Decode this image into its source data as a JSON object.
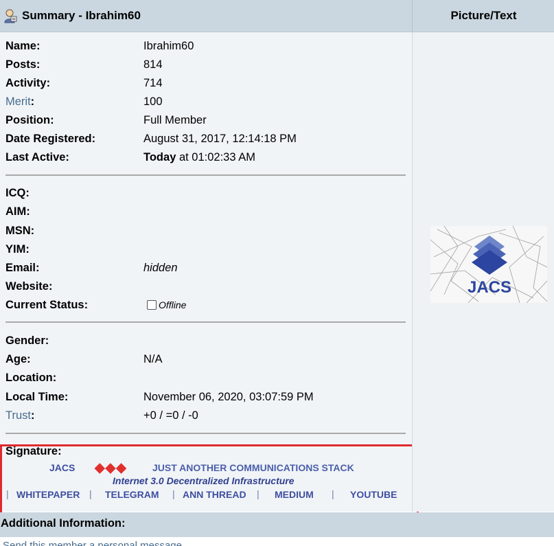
{
  "header": {
    "title": "Summary - Ibrahim60",
    "right_title": "Picture/Text"
  },
  "profile": {
    "name_label": "Name:",
    "name": "Ibrahim60",
    "posts_label": "Posts:",
    "posts": "814",
    "activity_label": "Activity:",
    "activity": "714",
    "merit_label": "Merit",
    "merit": "100",
    "position_label": "Position:",
    "position": "Full Member",
    "registered_label": "Date Registered:",
    "registered": "August 31, 2017, 12:14:18 PM",
    "last_active_label": "Last Active:",
    "last_active_bold": "Today",
    "last_active_rest": " at 01:02:33 AM",
    "icq_label": "ICQ:",
    "aim_label": "AIM:",
    "msn_label": "MSN:",
    "yim_label": "YIM:",
    "email_label": "Email:",
    "email": "hidden",
    "website_label": "Website:",
    "status_label": "Current Status:",
    "status": "Offline",
    "gender_label": "Gender:",
    "age_label": "Age:",
    "age": "N/A",
    "location_label": "Location:",
    "localtime_label": "Local Time:",
    "localtime": "November 06, 2020, 03:07:59 PM",
    "trust_label": "Trust",
    "trust": "+0 / =0 / -0"
  },
  "signature": {
    "label": "Signature:",
    "jacs": "JACS",
    "diamonds": "◆◆◆",
    "tagline": "JUST ANOTHER COMMUNICATIONS STACK",
    "subtitle": "Internet 3.0 Decentralized Infrastructure",
    "links": [
      "WHITEPAPER",
      "TELEGRAM",
      "ANN THREAD",
      "MEDIUM",
      "YOUTUBE"
    ],
    "diamond_color": "#e0302e"
  },
  "avatar": {
    "text": "JACS"
  },
  "additional": {
    "label": "Additional Information:",
    "cut_link": "Send this member a personal message."
  }
}
